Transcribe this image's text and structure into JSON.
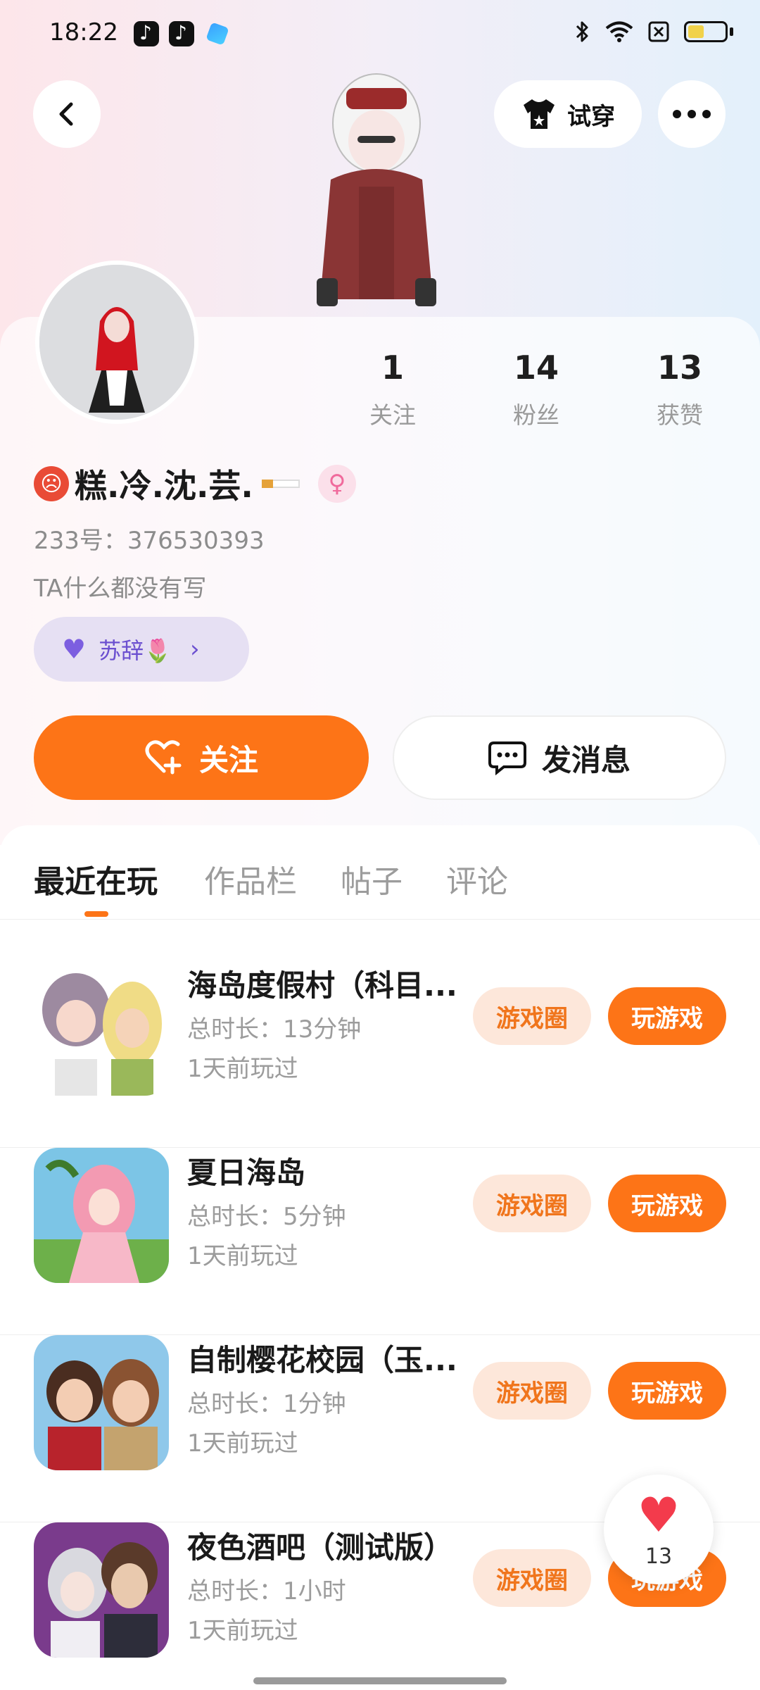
{
  "status_bar": {
    "time": "18:22",
    "bluetooth_icon": "bluetooth-icon",
    "wifi_icon": "wifi-icon",
    "sim_icon": "sim-icon",
    "battery_icon": "battery-icon"
  },
  "header": {
    "try_on_label": "试穿"
  },
  "profile": {
    "stats": [
      {
        "value": "1",
        "label": "关注"
      },
      {
        "value": "14",
        "label": "粉丝"
      },
      {
        "value": "13",
        "label": "获赞"
      }
    ],
    "nickname": "糕.冷.沈.芸.",
    "uid": "233号：376530393",
    "bio": "TA什么都没有写",
    "guild_name": "苏辞🌷",
    "follow_label": "关注",
    "message_label": "发消息"
  },
  "tabs": [
    {
      "label": "最近在玩",
      "active": true
    },
    {
      "label": "作品栏",
      "active": false
    },
    {
      "label": "帖子",
      "active": false
    },
    {
      "label": "评论",
      "active": false
    }
  ],
  "games": [
    {
      "title": "海岛度假村（科目...",
      "duration": "总时长：13分钟",
      "last_played": "1天前玩过",
      "circle_label": "游戏圈",
      "play_label": "玩游戏"
    },
    {
      "title": "夏日海岛",
      "duration": "总时长：5分钟",
      "last_played": "1天前玩过",
      "circle_label": "游戏圈",
      "play_label": "玩游戏"
    },
    {
      "title": "自制樱花校园（玉...",
      "duration": "总时长：1分钟",
      "last_played": "1天前玩过",
      "circle_label": "游戏圈",
      "play_label": "玩游戏"
    },
    {
      "title": "夜色酒吧（测试版）",
      "duration": "总时长：1小时",
      "last_played": "1天前玩过",
      "circle_label": "游戏圈",
      "play_label": "玩游戏"
    }
  ],
  "like_float": {
    "count": "13"
  },
  "colors": {
    "accent": "#fd7417",
    "accent_light": "#fde7da",
    "guild_bg": "#e6e0f3",
    "guild_text": "#6b4fd0"
  }
}
